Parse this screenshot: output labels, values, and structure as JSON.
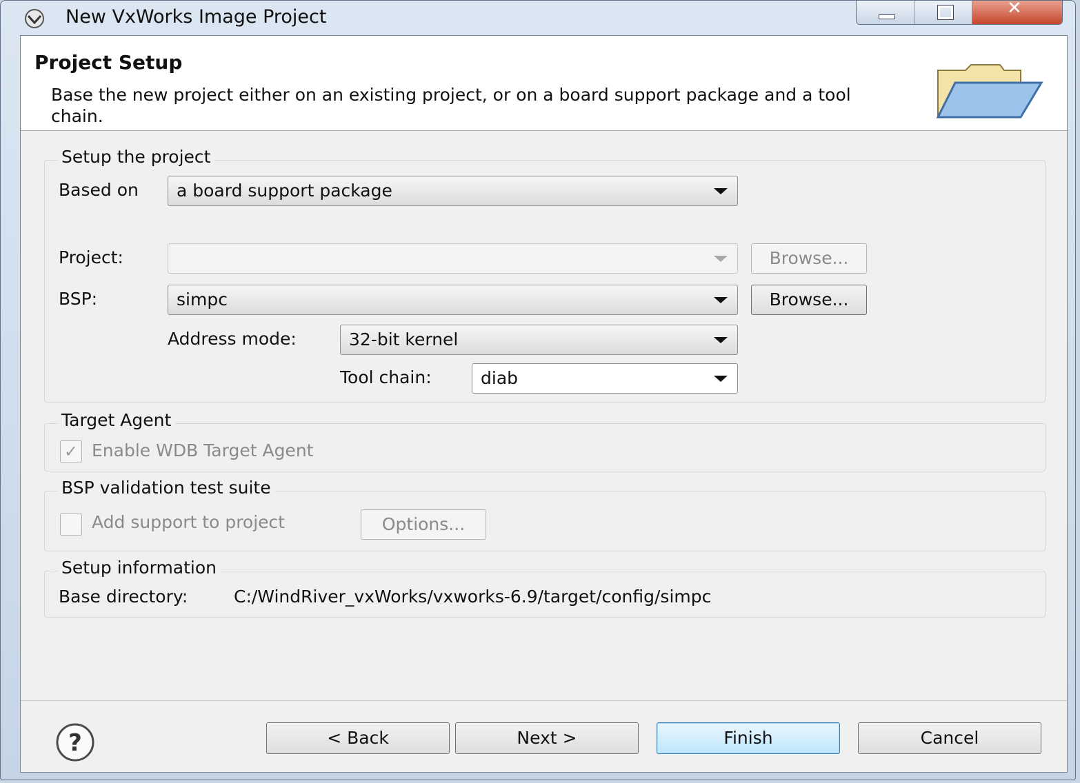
{
  "window": {
    "title": "New VxWorks Image Project"
  },
  "header": {
    "title": "Project Setup",
    "description": "Base the new project either on an existing project, or on a board support package and a tool chain."
  },
  "setup_group": {
    "legend": "Setup the project",
    "based_on_label": "Based on",
    "based_on_value": "a board support package",
    "project_label": "Project:",
    "project_value": "",
    "project_browse": "Browse...",
    "bsp_label": "BSP:",
    "bsp_value": "simpc",
    "bsp_browse": "Browse...",
    "address_mode_label": "Address mode:",
    "address_mode_value": "32-bit kernel",
    "tool_chain_label": "Tool chain:",
    "tool_chain_value": "diab"
  },
  "target_agent": {
    "legend": "Target Agent",
    "checkbox_label": "Enable WDB Target Agent",
    "checked": true
  },
  "validation": {
    "legend": "BSP validation test suite",
    "checkbox_label": "Add support to project",
    "checked": false,
    "options_button": "Options..."
  },
  "setup_info": {
    "legend": "Setup information",
    "base_dir_label": "Base directory:",
    "base_dir_value": "C:/WindRiver_vxWorks/vxworks-6.9/target/config/simpc"
  },
  "footer": {
    "back": "< Back",
    "next": "Next >",
    "finish": "Finish",
    "cancel": "Cancel"
  }
}
